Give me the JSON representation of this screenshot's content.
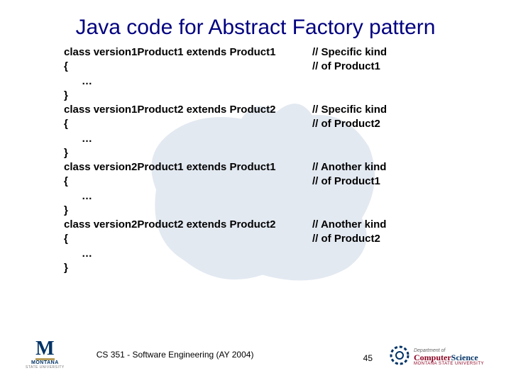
{
  "title": "Java code for Abstract Factory pattern",
  "code": [
    {
      "l": "class version1Product1 extends Product1",
      "r": "// Specific kind"
    },
    {
      "l": "{",
      "r": "// of Product1"
    },
    {
      "l": "      …",
      "r": ""
    },
    {
      "l": "}",
      "r": ""
    },
    {
      "l": "class version1Product2 extends Product2",
      "r": "// Specific kind"
    },
    {
      "l": "{",
      "r": "// of Product2"
    },
    {
      "l": "      …",
      "r": ""
    },
    {
      "l": "}",
      "r": ""
    },
    {
      "l": "class version2Product1 extends Product1",
      "r": "// Another kind"
    },
    {
      "l": "{",
      "r": "// of Product1"
    },
    {
      "l": "      …",
      "r": ""
    },
    {
      "l": "}",
      "r": ""
    },
    {
      "l": "class version2Product2 extends Product2",
      "r": "// Another kind"
    },
    {
      "l": "{",
      "r": "// of Product2"
    },
    {
      "l": "      …",
      "r": ""
    },
    {
      "l": "}",
      "r": ""
    }
  ],
  "footer": {
    "course": "CS 351 -  Software Engineering (AY 2004)",
    "page": "45",
    "msu_name": "MONTANA",
    "msu_sub": "STATE UNIVERSITY",
    "cs_dept": "Department of",
    "cs_word1": "Computer",
    "cs_word2": "Science",
    "cs_sub": "MONTANA STATE UNIVERSITY"
  }
}
